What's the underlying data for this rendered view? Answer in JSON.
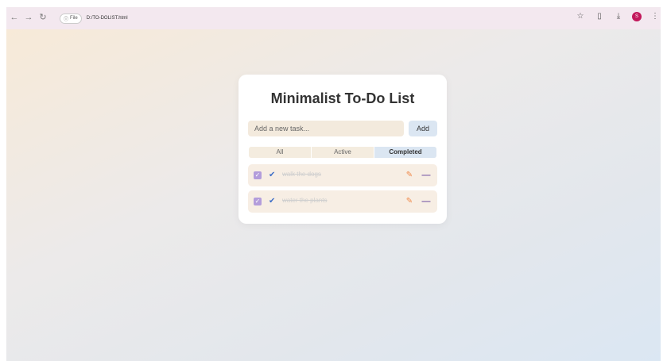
{
  "browser": {
    "back_icon": "arrow-left-icon",
    "forward_icon": "arrow-right-icon",
    "reload_icon": "reload-icon",
    "url_prefix": "File",
    "url": "D:/TO-DOLIST.html",
    "avatar_letter": "S"
  },
  "app": {
    "title": "Minimalist To-Do List",
    "input_placeholder": "Add a new task...",
    "add_label": "Add",
    "filters": [
      {
        "label": "All",
        "active": false
      },
      {
        "label": "Active",
        "active": false
      },
      {
        "label": "Completed",
        "active": true
      }
    ],
    "tasks": [
      {
        "text": "walk the dogs",
        "completed": true
      },
      {
        "text": "water the plants",
        "completed": true
      }
    ]
  },
  "colors": {
    "accent": "#dbe6f2",
    "checkbox": "#b39ddb",
    "edit": "#f08a4b",
    "delete": "#7b5ea7",
    "check": "#3f6fc7"
  }
}
